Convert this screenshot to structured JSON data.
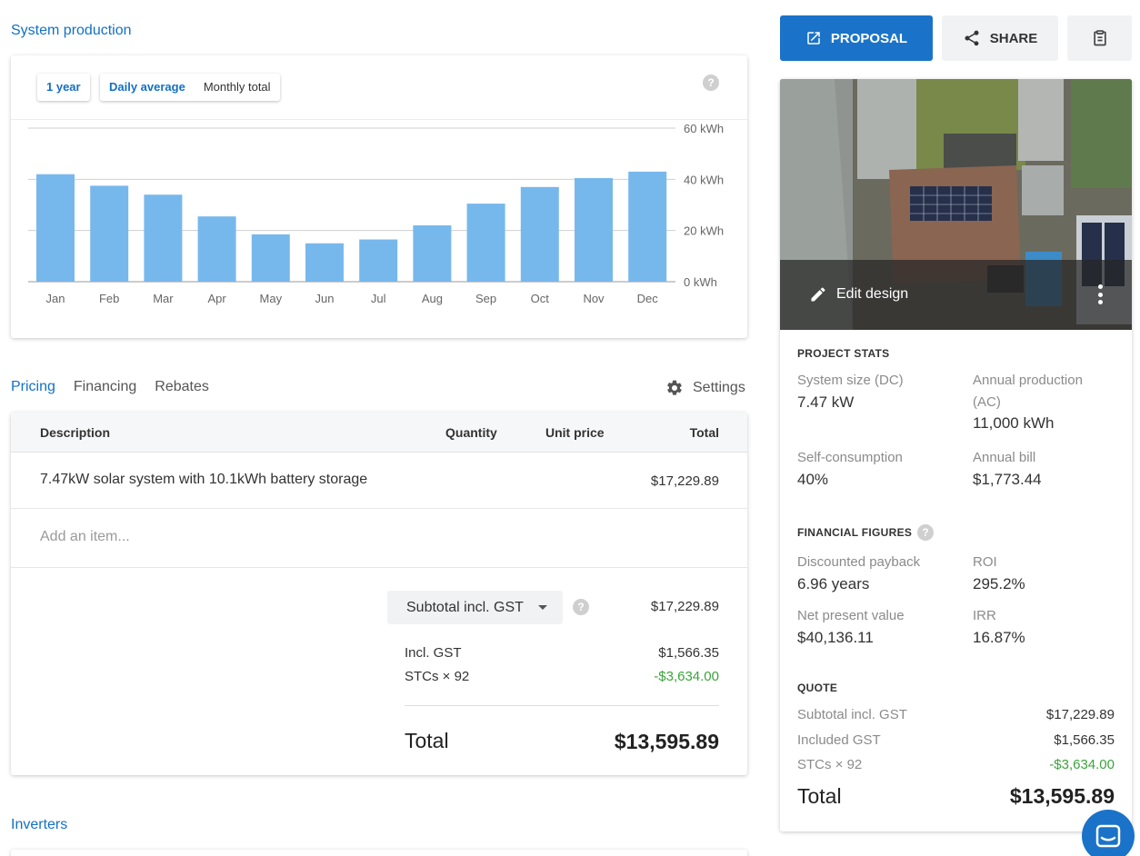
{
  "production": {
    "title": "System production",
    "period_button": "1 year",
    "toggle": [
      "Daily average",
      "Monthly total"
    ],
    "help": "?"
  },
  "chart_data": {
    "type": "bar",
    "categories": [
      "Jan",
      "Feb",
      "Mar",
      "Apr",
      "May",
      "Jun",
      "Jul",
      "Aug",
      "Sep",
      "Oct",
      "Nov",
      "Dec"
    ],
    "values": [
      42,
      37.5,
      34,
      25.5,
      18.5,
      15,
      16.5,
      22,
      30.5,
      37,
      40.5,
      43
    ],
    "y_ticks": [
      "0 kWh",
      "20 kWh",
      "40 kWh",
      "60 kWh"
    ],
    "ylim": [
      0,
      60
    ],
    "unit": "kWh",
    "color": "#77b8ec",
    "grid": true
  },
  "tabs": [
    "Pricing",
    "Financing",
    "Rebates"
  ],
  "settings_label": "Settings",
  "pricing": {
    "headers": {
      "description": "Description",
      "quantity": "Quantity",
      "unit_price": "Unit price",
      "total": "Total"
    },
    "item": {
      "description": "7.47kW solar system with 10.1kWh battery storage",
      "total": "$17,229.89"
    },
    "add_item_placeholder": "Add an item...",
    "subtotal_label": "Subtotal incl. GST",
    "subtotal_value": "$17,229.89",
    "gst_label": "Incl. GST",
    "gst_value": "$1,566.35",
    "stc_label": "STCs × 92",
    "stc_value": "-$3,634.00",
    "total_label": "Total",
    "total_value": "$13,595.89"
  },
  "inverters_title": "Inverters",
  "actions": {
    "proposal": "PROPOSAL",
    "share": "SHARE"
  },
  "design": {
    "edit_label": "Edit design"
  },
  "project_stats": {
    "heading": "PROJECT STATS",
    "system_size_label": "System size (DC)",
    "system_size_value": "7.47 kW",
    "annual_production_label": "Annual production (AC)",
    "annual_production_value": "11,000 kWh",
    "self_consumption_label": "Self-consumption",
    "self_consumption_value": "40%",
    "annual_bill_label": "Annual bill",
    "annual_bill_value": "$1,773.44"
  },
  "financial": {
    "heading": "FINANCIAL FIGURES",
    "payback_label": "Discounted payback",
    "payback_value": "6.96 years",
    "roi_label": "ROI",
    "roi_value": "295.2%",
    "npv_label": "Net present value",
    "npv_value": "$40,136.11",
    "irr_label": "IRR",
    "irr_value": "16.87%"
  },
  "quote": {
    "heading": "QUOTE",
    "subtotal_label": "Subtotal incl. GST",
    "subtotal_value": "$17,229.89",
    "gst_label": "Included GST",
    "gst_value": "$1,566.35",
    "stc_label": "STCs × 92",
    "stc_value": "-$3,634.00",
    "total_label": "Total",
    "total_value": "$13,595.89"
  }
}
